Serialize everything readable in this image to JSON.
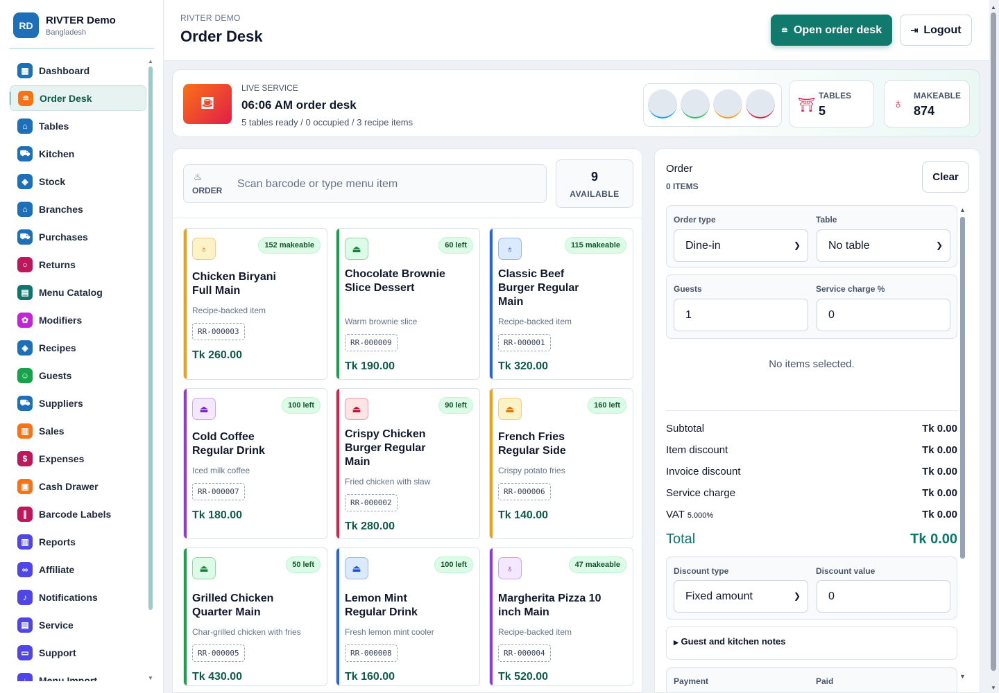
{
  "brand": {
    "initials": "RD",
    "title": "RIVTER Demo",
    "subtitle": "Bangladesh"
  },
  "nav": [
    {
      "label": "Dashboard",
      "icon": "dashboard-icon",
      "color": "#1d6fb8",
      "glyph": "▦"
    },
    {
      "label": "Order Desk",
      "icon": "order-icon",
      "color": "#f97316",
      "glyph": "≘",
      "active": true
    },
    {
      "label": "Tables",
      "icon": "tables-icon",
      "color": "#1d6fb8",
      "glyph": "⌂"
    },
    {
      "label": "Kitchen",
      "icon": "kitchen-icon",
      "color": "#1d6fb8",
      "glyph": "⛟"
    },
    {
      "label": "Stock",
      "icon": "stock-icon",
      "color": "#1d6fb8",
      "glyph": "◈"
    },
    {
      "label": "Branches",
      "icon": "branches-icon",
      "color": "#1d6fb8",
      "glyph": "⌂"
    },
    {
      "label": "Purchases",
      "icon": "purchases-icon",
      "color": "#1d6fb8",
      "glyph": "⛟"
    },
    {
      "label": "Returns",
      "icon": "returns-icon",
      "color": "#be185d",
      "glyph": "○"
    },
    {
      "label": "Menu Catalog",
      "icon": "menu-catalog-icon",
      "color": "#0f766e",
      "glyph": "▤"
    },
    {
      "label": "Modifiers",
      "icon": "modifiers-icon",
      "color": "#c026d3",
      "glyph": "✿"
    },
    {
      "label": "Recipes",
      "icon": "recipes-icon",
      "color": "#1d6fb8",
      "glyph": "◈"
    },
    {
      "label": "Guests",
      "icon": "guests-icon",
      "color": "#16a34a",
      "glyph": "☺"
    },
    {
      "label": "Suppliers",
      "icon": "suppliers-icon",
      "color": "#1d6fb8",
      "glyph": "⛟"
    },
    {
      "label": "Sales",
      "icon": "sales-icon",
      "color": "#f97316",
      "glyph": "▥"
    },
    {
      "label": "Expenses",
      "icon": "expenses-icon",
      "color": "#be185d",
      "glyph": "$"
    },
    {
      "label": "Cash Drawer",
      "icon": "cash-drawer-icon",
      "color": "#f97316",
      "glyph": "▣"
    },
    {
      "label": "Barcode Labels",
      "icon": "barcode-icon",
      "color": "#be185d",
      "glyph": "∥"
    },
    {
      "label": "Reports",
      "icon": "reports-icon",
      "color": "#4f46e5",
      "glyph": "▥"
    },
    {
      "label": "Affiliate",
      "icon": "affiliate-icon",
      "color": "#4f46e5",
      "glyph": "∞"
    },
    {
      "label": "Notifications",
      "icon": "bell-icon",
      "color": "#4f46e5",
      "glyph": "♪"
    },
    {
      "label": "Service",
      "icon": "service-icon",
      "color": "#4f46e5",
      "glyph": "▤"
    },
    {
      "label": "Support",
      "icon": "support-icon",
      "color": "#4f46e5",
      "glyph": "▭"
    },
    {
      "label": "Menu Import",
      "icon": "import-icon",
      "color": "#4f46e5",
      "glyph": "↓"
    }
  ],
  "header": {
    "eyebrow": "RIVTER DEMO",
    "title": "Order Desk",
    "open_button": "Open order desk",
    "logout_button": "Logout"
  },
  "banner": {
    "eyebrow": "LIVE SERVICE",
    "title": "06:06 AM order desk",
    "subtitle": "5 tables ready / 0 occupied / 3 recipe items",
    "avatar_accents": [
      "#0ea5e9",
      "#22c55e",
      "#f59e0b",
      "#e11d48"
    ],
    "tables_label": "TABLES",
    "tables_value": "5",
    "makeable_label": "MAKEABLE",
    "makeable_value": "874"
  },
  "search": {
    "label": "ORDER",
    "placeholder": "Scan barcode or type menu item"
  },
  "available": {
    "count": "9",
    "label": "AVAILABLE"
  },
  "items": [
    {
      "name": "Chicken Biryani Full Main",
      "badge": "152 makeable",
      "desc": "Recipe-backed item",
      "code": "RR-000003",
      "price": "Tk 260.00",
      "accent": "#f59e0b",
      "icon_bg": "#fef3c7",
      "icon_fg": "#d97706",
      "glyph": "♁",
      "lines": 2
    },
    {
      "name": "Chocolate Brownie Slice Dessert",
      "badge": "60 left",
      "desc": "Warm brownie slice",
      "code": "RR-000009",
      "price": "Tk 190.00",
      "accent": "#16a34a",
      "icon_bg": "#dcfce7",
      "icon_fg": "#15803d",
      "glyph": "⏏",
      "lines": 3
    },
    {
      "name": "Classic Beef Burger Regular Main",
      "badge": "115 makeable",
      "desc": "Recipe-backed item",
      "code": "RR-000001",
      "price": "Tk 320.00",
      "accent": "#2563eb",
      "icon_bg": "#dbeafe",
      "icon_fg": "#1d4ed8",
      "glyph": "♁",
      "lines": 3
    },
    {
      "name": "Cold Coffee Regular Drink",
      "badge": "100 left",
      "desc": "Iced milk coffee",
      "code": "RR-000007",
      "price": "Tk 180.00",
      "accent": "#9333ea",
      "icon_bg": "#f3e8ff",
      "icon_fg": "#7e22ce",
      "glyph": "⏏",
      "lines": 2
    },
    {
      "name": "Crispy Chicken Burger Regular Main",
      "badge": "90 left",
      "desc": "Fried chicken with slaw",
      "code": "RR-000002",
      "price": "Tk 280.00",
      "accent": "#e11d48",
      "icon_bg": "#ffe4e6",
      "icon_fg": "#be123c",
      "glyph": "⏏",
      "lines": 3
    },
    {
      "name": "French Fries Regular Side",
      "badge": "160 left",
      "desc": "Crispy potato fries",
      "code": "RR-000006",
      "price": "Tk 140.00",
      "accent": "#f59e0b",
      "icon_bg": "#fef3c7",
      "icon_fg": "#d97706",
      "glyph": "⏏",
      "lines": 2
    },
    {
      "name": "Grilled Chicken Quarter Main",
      "badge": "50 left",
      "desc": "Char-grilled chicken with fries",
      "code": "RR-000005",
      "price": "Tk 430.00",
      "accent": "#16a34a",
      "icon_bg": "#dcfce7",
      "icon_fg": "#15803d",
      "glyph": "⏏",
      "lines": 2
    },
    {
      "name": "Lemon Mint Regular Drink",
      "badge": "100 left",
      "desc": "Fresh lemon mint cooler",
      "code": "RR-000008",
      "price": "Tk 160.00",
      "accent": "#2563eb",
      "icon_bg": "#dbeafe",
      "icon_fg": "#1d4ed8",
      "glyph": "⏏",
      "lines": 2
    },
    {
      "name": "Margherita Pizza 10 inch Main",
      "badge": "47 makeable",
      "desc": "Recipe-backed item",
      "code": "RR-000004",
      "price": "Tk 520.00",
      "accent": "#9333ea",
      "icon_bg": "#f3e8ff",
      "icon_fg": "#7e22ce",
      "glyph": "♁",
      "lines": 2
    }
  ],
  "order": {
    "title": "Order",
    "count": "0 ITEMS",
    "clear_button": "Clear",
    "order_type_label": "Order type",
    "order_type_value": "Dine-in",
    "table_label": "Table",
    "table_value": "No table",
    "guests_label": "Guests",
    "guests_value": "1",
    "service_label": "Service charge %",
    "service_value": "0",
    "empty_text": "No items selected.",
    "totals": [
      {
        "label": "Subtotal",
        "value": "Tk 0.00"
      },
      {
        "label": "Item discount",
        "value": "Tk 0.00"
      },
      {
        "label": "Invoice discount",
        "value": "Tk 0.00"
      },
      {
        "label": "Service charge",
        "value": "Tk 0.00"
      },
      {
        "label": "VAT",
        "sub": "5.000%",
        "value": "Tk 0.00"
      }
    ],
    "total_label": "Total",
    "total_value": "Tk 0.00",
    "discount_type_label": "Discount type",
    "discount_type_value": "Fixed amount",
    "discount_value_label": "Discount value",
    "discount_value": "0",
    "notes_label": "Guest and kitchen notes",
    "payment_label": "Payment",
    "paid_label": "Paid"
  }
}
